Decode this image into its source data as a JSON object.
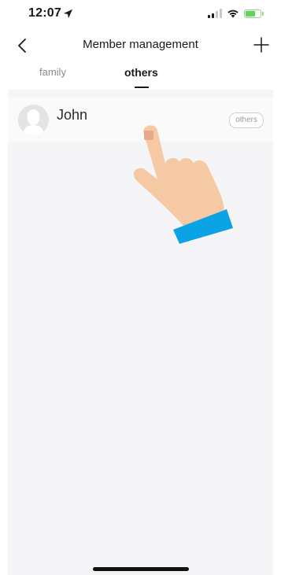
{
  "status_bar": {
    "time": "12:07",
    "icons": [
      "location-arrow-icon",
      "signal-icon",
      "wifi-icon",
      "battery-charging-icon"
    ]
  },
  "nav": {
    "title": "Member management",
    "back_icon": "chevron-left-icon",
    "add_icon": "plus-icon"
  },
  "tabs": [
    {
      "label": "family",
      "active": false
    },
    {
      "label": "others",
      "active": true
    }
  ],
  "members": [
    {
      "name": "John",
      "role": "others",
      "avatar_icon": "default-avatar-icon"
    }
  ],
  "overlay": {
    "icon": "tap-hand-icon"
  },
  "colors": {
    "background": "#ffffff",
    "list_background": "#f5f5f7",
    "text_primary": "#1a1a1a",
    "text_muted": "#8a8a8a",
    "hand_skin": "#f5c9a3",
    "hand_sleeve": "#0aa3e6",
    "battery": "#5fd35a"
  }
}
